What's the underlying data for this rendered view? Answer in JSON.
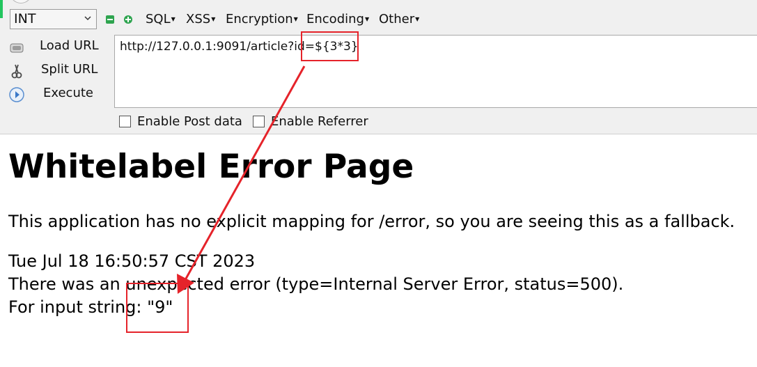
{
  "toolbar": {
    "select_value": "INT",
    "menus": [
      "SQL",
      "XSS",
      "Encryption",
      "Encoding",
      "Other"
    ],
    "side_actions": {
      "load": "Load URL",
      "split": "Split URL",
      "execute": "Execute"
    },
    "url": "http://127.0.0.1:9091/article?id=${3*3}",
    "enable_post": "Enable Post data",
    "enable_referrer": "Enable Referrer"
  },
  "page": {
    "title": "Whitelabel Error Page",
    "message": "This application has no explicit mapping for /error, so you are seeing this as a fallback.",
    "timestamp": "Tue Jul 18 16:50:57 CST 2023",
    "error": "There was an unexpected error (type=Internal Server Error, status=500).",
    "detail": "For input string: \"9\""
  },
  "colors": {
    "annotation": "#e5232a",
    "toolbar_bg": "#f0f0f0",
    "accent_green": "#2ea44f"
  },
  "icons": [
    "chevron-down-icon",
    "minus-icon",
    "plus-icon",
    "load-url-icon",
    "split-url-icon",
    "execute-icon",
    "annotation-arrow-icon"
  ]
}
